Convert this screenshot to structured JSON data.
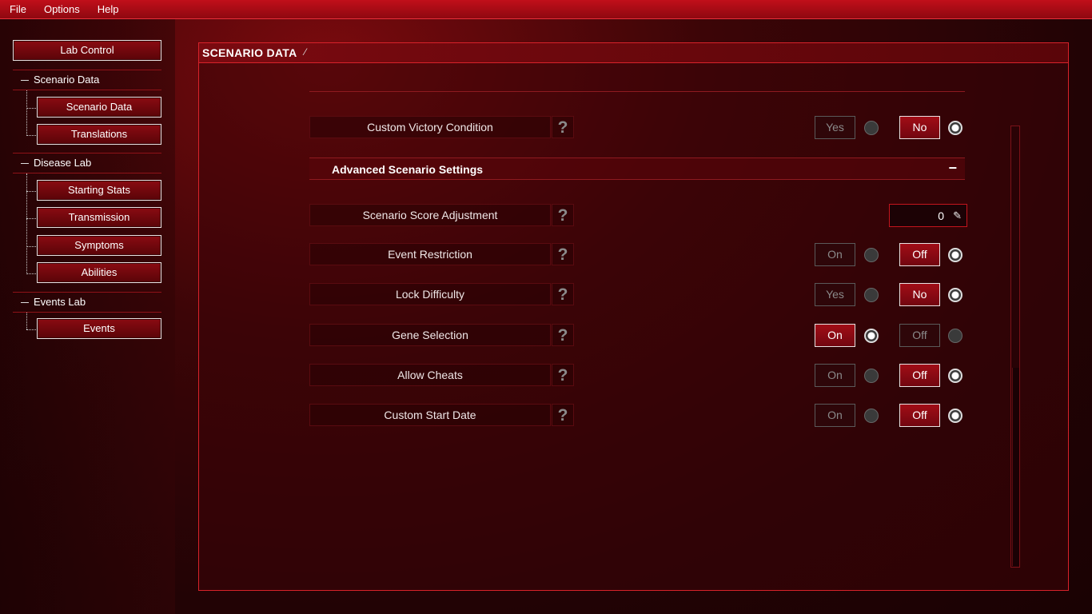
{
  "menu": [
    "File",
    "Options",
    "Help"
  ],
  "sidebar": {
    "lab_control": "Lab Control",
    "sections": [
      {
        "title": "Scenario Data",
        "items": [
          "Scenario Data",
          "Translations"
        ]
      },
      {
        "title": "Disease Lab",
        "items": [
          "Starting Stats",
          "Transmission",
          "Symptoms",
          "Abilities"
        ]
      },
      {
        "title": "Events Lab",
        "items": [
          "Events"
        ]
      }
    ]
  },
  "panel": {
    "title": "SCENARIO DATA",
    "advanced_title": "Advanced Scenario Settings",
    "collapse_glyph": "−",
    "help_glyph": "?",
    "score_value": "0",
    "pencil_glyph": "✎"
  },
  "rows": [
    {
      "label": "Custom Victory Condition",
      "opt1": "Yes",
      "opt2": "No",
      "selected": 2
    },
    {
      "label": "Scenario Score Adjustment"
    },
    {
      "label": "Event Restriction",
      "opt1": "On",
      "opt2": "Off",
      "selected": 2
    },
    {
      "label": "Lock Difficulty",
      "opt1": "Yes",
      "opt2": "No",
      "selected": 2
    },
    {
      "label": "Gene Selection",
      "opt1": "On",
      "opt2": "Off",
      "selected": 1
    },
    {
      "label": "Allow Cheats",
      "opt1": "On",
      "opt2": "Off",
      "selected": 2
    },
    {
      "label": "Custom Start Date",
      "opt1": "On",
      "opt2": "Off",
      "selected": 2
    }
  ],
  "colors": {
    "accent": "#d8222a",
    "active_button": "#a10d16"
  }
}
